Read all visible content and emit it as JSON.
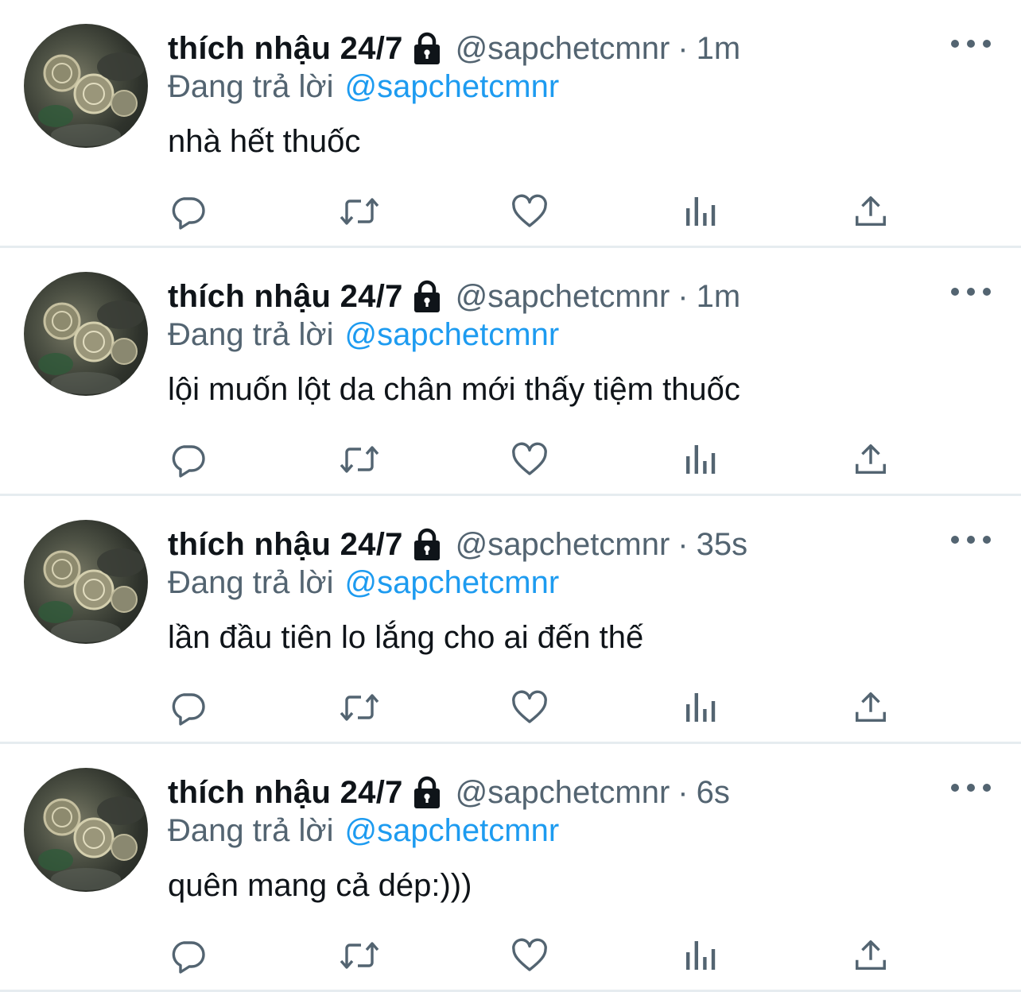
{
  "colors": {
    "text": "#0f1419",
    "secondary": "#536471",
    "link": "#1d9bf0",
    "divider": "#e6ecf0"
  },
  "icons": {
    "protected": "lock-icon",
    "more": "more-icon",
    "reply": "reply-icon",
    "retweet": "retweet-icon",
    "like": "heart-icon",
    "views": "analytics-icon",
    "share": "share-icon"
  },
  "tweets": [
    {
      "display_name": "thích nhậu 24/7",
      "handle": "@sapchetcmnr",
      "separator": "·",
      "time": "1m",
      "replying_label": "Đang trả lời",
      "replying_to": "@sapchetcmnr",
      "text": "nhà hết thuốc"
    },
    {
      "display_name": "thích nhậu 24/7",
      "handle": "@sapchetcmnr",
      "separator": "·",
      "time": "1m",
      "replying_label": "Đang trả lời",
      "replying_to": "@sapchetcmnr",
      "text": "lội muốn lột da chân mới thấy tiệm thuốc"
    },
    {
      "display_name": "thích nhậu 24/7",
      "handle": "@sapchetcmnr",
      "separator": "·",
      "time": "35s",
      "replying_label": "Đang trả lời",
      "replying_to": "@sapchetcmnr",
      "text": "lần đầu tiên lo lắng cho ai đến thế"
    },
    {
      "display_name": "thích nhậu 24/7",
      "handle": "@sapchetcmnr",
      "separator": "·",
      "time": "6s",
      "replying_label": "Đang trả lời",
      "replying_to": "@sapchetcmnr",
      "text": "quên mang cả dép:)))"
    }
  ]
}
